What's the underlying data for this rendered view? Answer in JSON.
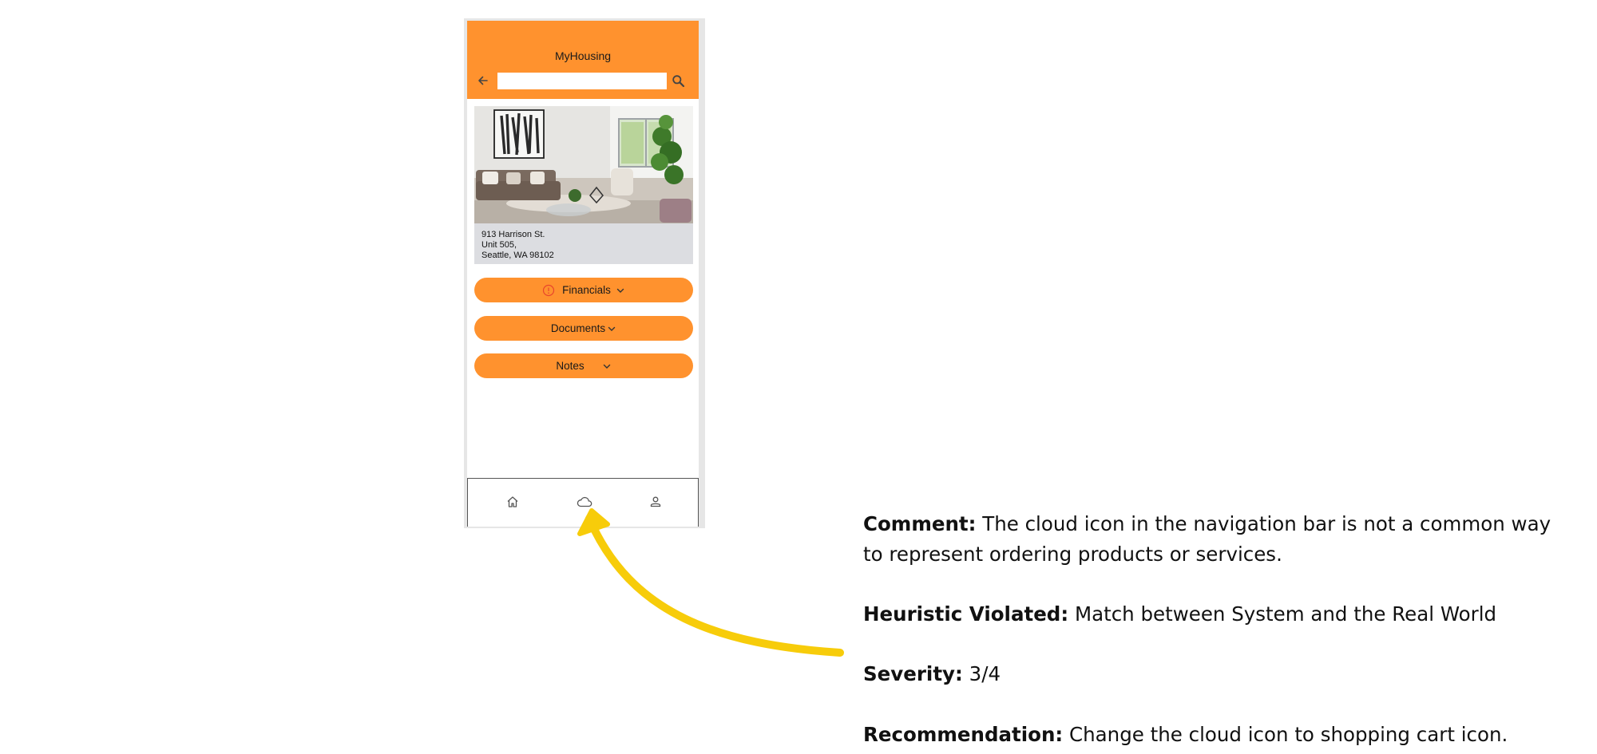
{
  "app": {
    "title": "MyHousing",
    "search": {
      "value": "",
      "placeholder": ""
    },
    "listing": {
      "address_lines": [
        "913 Harrison St.",
        "Unit 505,",
        "Seattle, WA 98102"
      ]
    },
    "sections": [
      {
        "label": "Financials",
        "icon": "alert-circle-icon"
      },
      {
        "label": "Documents"
      },
      {
        "label": "Notes"
      }
    ],
    "bottom_nav": [
      "home-icon",
      "cloud-icon",
      "user-icon"
    ],
    "colors": {
      "accent": "#ff922e",
      "card": "#dcdde1",
      "alert": "#e8452c"
    }
  },
  "annotation": {
    "comment_label": "Comment:",
    "comment_text": "The cloud icon in the navigation bar is not a common way to represent ordering products or services.",
    "heuristic_label": "Heuristic Violated:",
    "heuristic_text": "Match between System and the Real World",
    "severity_label": "Severity:",
    "severity_text": "3/4",
    "recommendation_label": "Recommendation:",
    "recommendation_text": "Change the cloud icon to shopping cart icon.",
    "arrow_color": "#f7cc0a"
  }
}
